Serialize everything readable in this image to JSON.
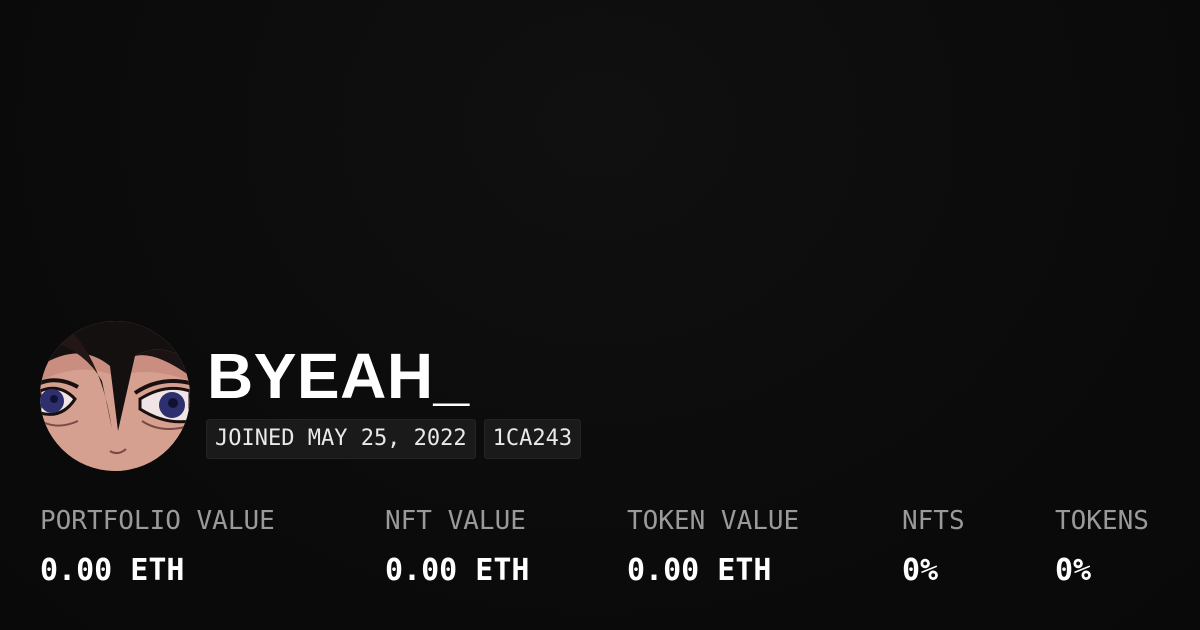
{
  "profile": {
    "username": "BYEAH_",
    "joined": "JOINED MAY 25, 2022",
    "address_tag": "1CA243",
    "avatar_icon": "anime-face-avatar-icon"
  },
  "stats": [
    {
      "label": "PORTFOLIO VALUE",
      "value": "0.00 ETH"
    },
    {
      "label": "NFT VALUE",
      "value": "0.00 ETH"
    },
    {
      "label": "TOKEN VALUE",
      "value": "0.00 ETH"
    },
    {
      "label": "NFTS",
      "value": "0%"
    },
    {
      "label": "TOKENS",
      "value": "0%"
    }
  ],
  "colors": {
    "background": "#0b0b0b",
    "text": "#ffffff",
    "label": "#9a9a9a",
    "badge_bg": "#1a1a1a"
  }
}
